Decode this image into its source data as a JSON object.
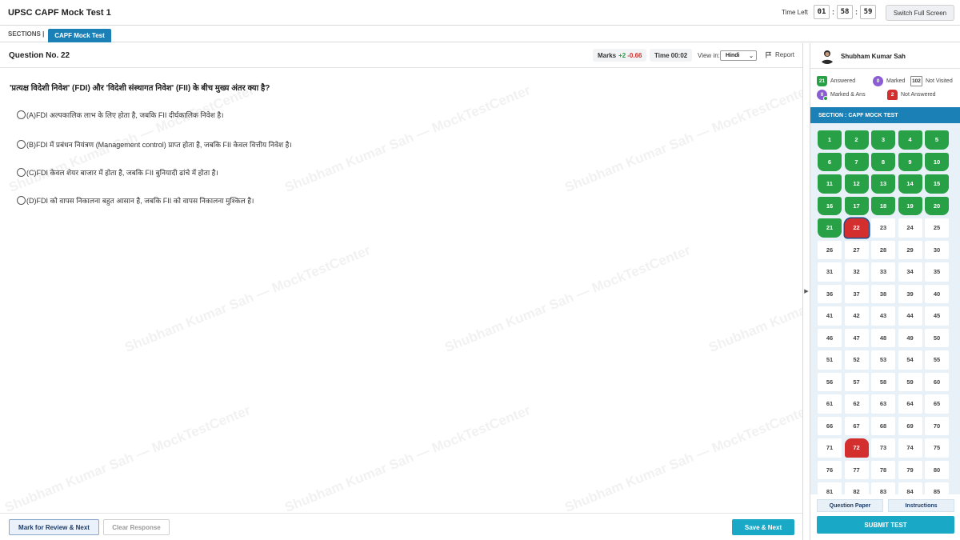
{
  "header": {
    "title": "UPSC CAPF Mock Test 1",
    "time_left_label": "Time Left",
    "time": {
      "hours": "01",
      "minutes": "58",
      "seconds": "59"
    },
    "fullscreen_label": "Switch Full Screen"
  },
  "sections": {
    "label": "SECTIONS |",
    "active_tab": "CAPF Mock Test"
  },
  "question": {
    "number_label": "Question No. 22",
    "marks_label": "Marks",
    "marks_positive": "+2",
    "marks_negative": "-0.66",
    "time_label": "Time 00:02",
    "view_in_label": "View in:",
    "language": "Hindi",
    "report_label": "Report",
    "text": "'प्रत्यक्ष विदेशी निवेश' (FDI) और 'विदेशी संस्थागत निवेश' (FII) के बीच मुख्य अंतर क्या है?",
    "options": [
      "(A)FDI अल्पकालिक लाभ के लिए होता है, जबकि FII दीर्घकालिक निवेश है।",
      "(B)FDI में प्रबंधन नियंत्रण (Management control) प्राप्त होता है, जबकि FII केवल वित्तीय निवेश है।",
      "(C)FDI केवल शेयर बाजार में होता है, जबकि FII बुनियादी ढांचे में होता है।",
      "(D)FDI को वापस निकालना बहुत आसान है, जबकि FII को वापस निकालना मुश्किल है।"
    ]
  },
  "watermark_text": "Shubham Kumar Sah — MockTestCenter",
  "footer": {
    "mark_review_label": "Mark for Review & Next",
    "clear_label": "Clear Response",
    "save_next_label": "Save & Next"
  },
  "panel": {
    "user_name": "Shubham Kumar Sah",
    "legend": {
      "answered": {
        "count": "21",
        "label": "Answered"
      },
      "marked": {
        "count": "0",
        "label": "Marked"
      },
      "not_visited": {
        "count": "102",
        "label": "Not Visited"
      },
      "marked_ans": {
        "count": "0",
        "label": "Marked & Ans"
      },
      "not_answered": {
        "count": "2",
        "label": "Not Answered"
      }
    },
    "section_title": "SECTION : CAPF MOCK TEST",
    "question_paper_label": "Question Paper",
    "instructions_label": "Instructions",
    "submit_label": "SUBMIT TEST",
    "colors": {
      "answered": "#27a046",
      "not_answered": "#d32f2f",
      "marked": "#8a5cd6",
      "accent": "#1a80b6",
      "action": "#19a9c7"
    },
    "palette": {
      "visible_numbers": [
        1,
        2,
        3,
        4,
        5,
        6,
        7,
        8,
        9,
        10,
        11,
        12,
        13,
        14,
        15,
        16,
        17,
        18,
        19,
        20,
        21,
        22,
        23,
        24,
        25,
        26,
        27,
        28,
        29,
        30,
        31,
        32,
        33,
        34,
        35,
        36,
        37,
        38,
        39,
        40,
        41,
        42,
        43,
        44,
        45,
        46,
        47,
        48,
        49,
        50,
        51,
        52,
        53,
        54,
        55,
        56,
        57,
        58,
        59,
        60,
        61,
        62,
        63,
        64,
        65,
        66,
        67,
        68,
        69,
        70,
        71,
        72,
        73,
        74,
        75,
        76,
        77,
        78,
        79,
        80,
        81,
        82,
        83,
        84,
        85
      ],
      "answered": [
        1,
        2,
        3,
        4,
        5,
        6,
        7,
        8,
        9,
        10,
        11,
        12,
        13,
        14,
        15,
        16,
        17,
        18,
        19,
        20,
        21
      ],
      "not_answered": [
        22,
        72
      ],
      "current": 22
    }
  }
}
